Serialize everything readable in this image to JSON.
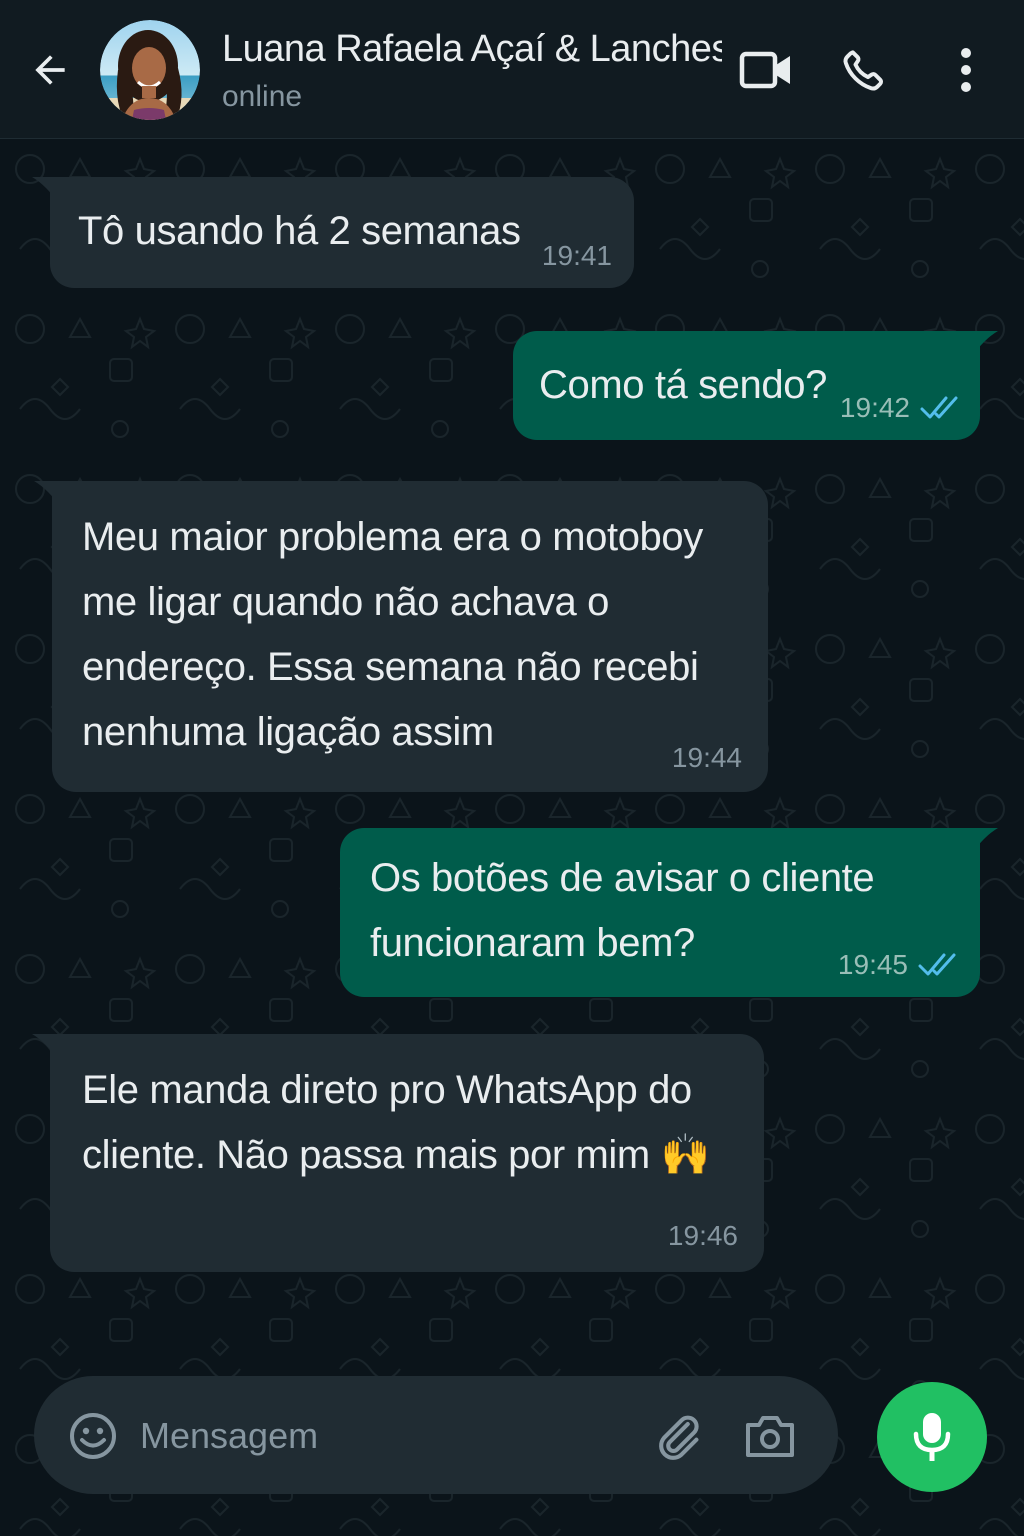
{
  "header": {
    "contact_name": "Luana Rafaela Açaí & Lanches",
    "status": "online",
    "icons": {
      "back": "arrow-left-icon",
      "video": "video-call-icon",
      "call": "phone-icon",
      "menu": "more-vertical-icon"
    }
  },
  "messages": [
    {
      "direction": "in",
      "text": "Tô usando há 2 semanas",
      "time": "19:41"
    },
    {
      "direction": "out",
      "text": "Como tá sendo?",
      "time": "19:42",
      "status": "read"
    },
    {
      "direction": "in",
      "text": "Meu maior problema era o motoboy me ligar quando não achava o endereço. Essa semana não recebi nenhuma ligação assim",
      "time": "19:44"
    },
    {
      "direction": "out",
      "text": "Os botões de avisar o cliente funcionaram bem?",
      "time": "19:45",
      "status": "read"
    },
    {
      "direction": "in",
      "text": "Ele manda direto pro WhatsApp do cliente. Não passa mais por mim 🙌",
      "time": "19:46"
    }
  ],
  "composer": {
    "placeholder": "Mensagem",
    "value": "",
    "icons": {
      "emoji": "emoji-icon",
      "attach": "paperclip-icon",
      "camera": "camera-icon",
      "mic": "microphone-icon"
    }
  },
  "colors": {
    "background": "#0b141a",
    "header": "#111b21",
    "incoming_bubble": "#202c33",
    "outgoing_bubble": "#005c4b",
    "accent": "#21c063",
    "read_ticks": "#53bdeb",
    "secondary_text": "#8696a0"
  }
}
